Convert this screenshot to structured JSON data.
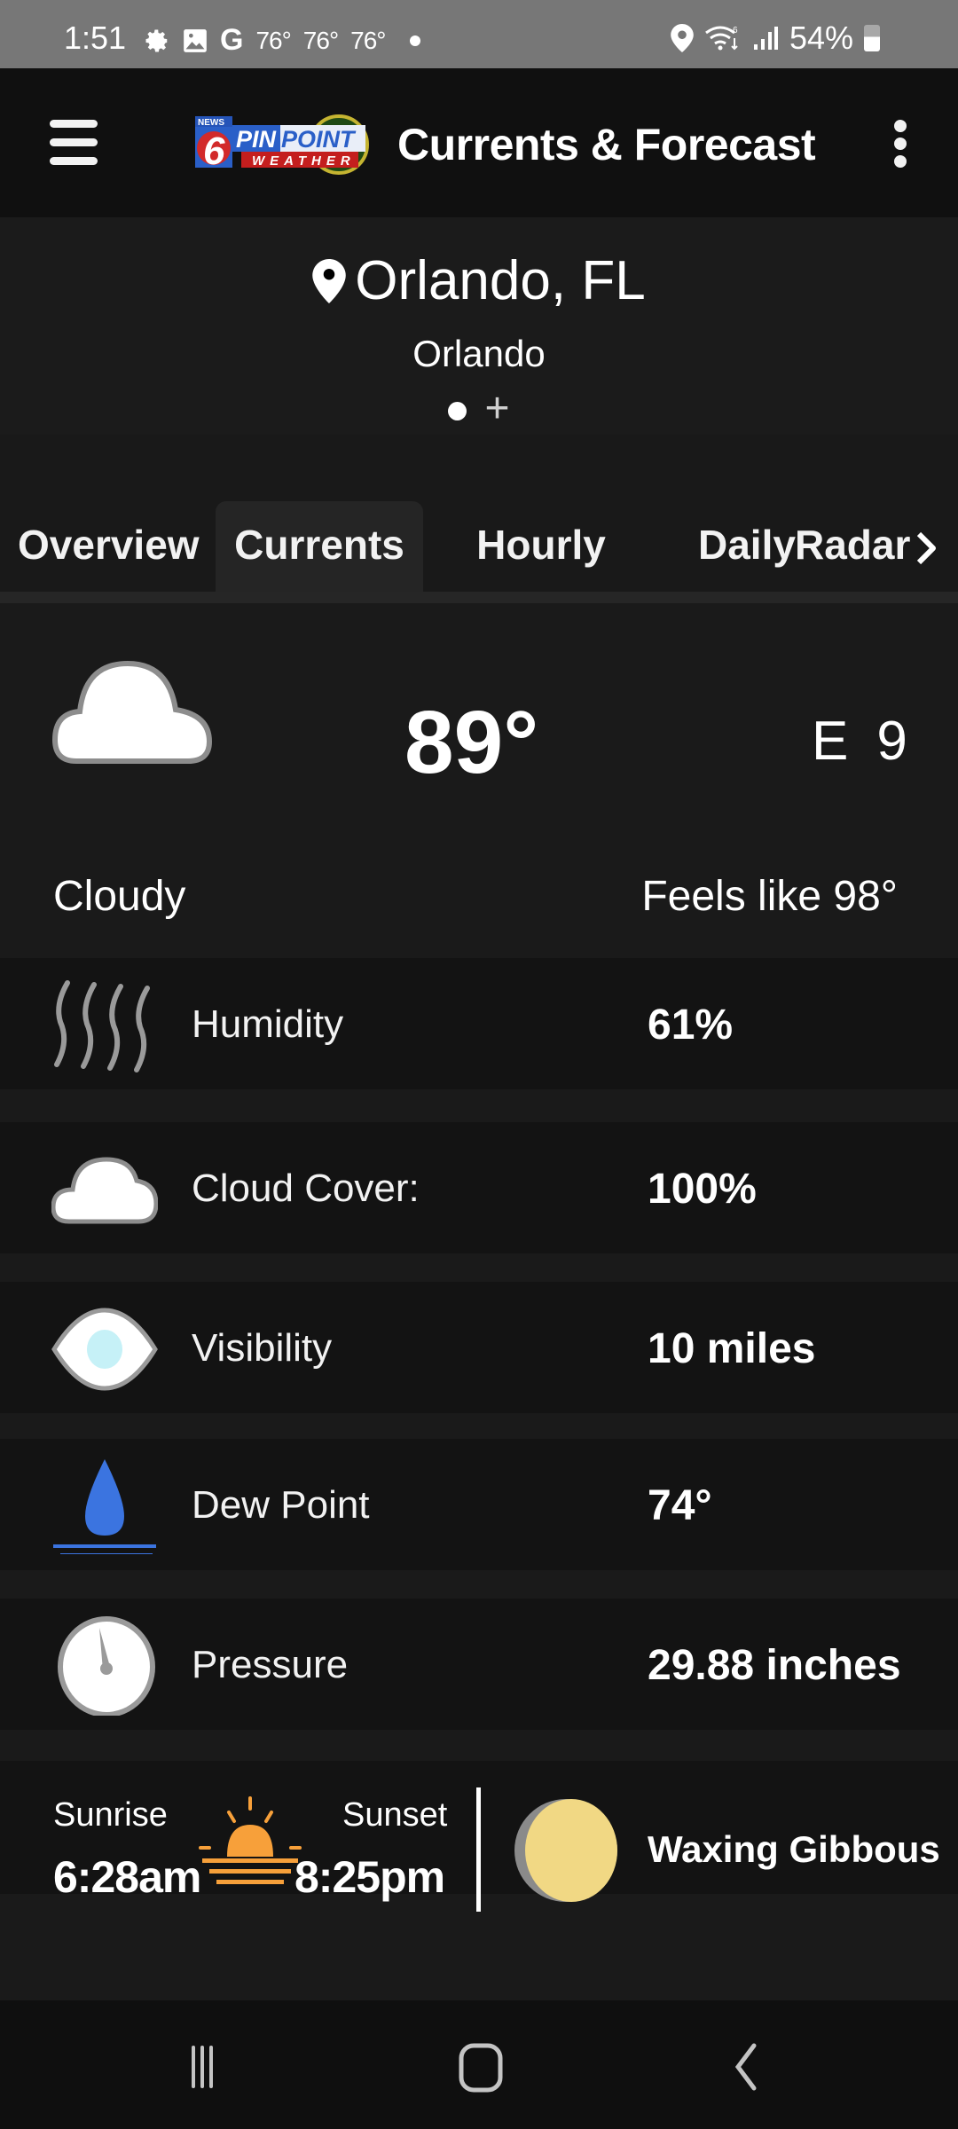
{
  "status_bar": {
    "time": "1:51",
    "left_icons": [
      "gear-icon",
      "image-icon",
      "google-icon"
    ],
    "temps": [
      "76°",
      "76°",
      "76°"
    ],
    "right_icons": [
      "location-icon",
      "wifi-icon",
      "signal-icon"
    ],
    "battery": "54%",
    "battery_level_percent": 54
  },
  "header": {
    "menu_icon": "hamburger-menu-icon",
    "logo": {
      "line1": "PINPOINT",
      "line2": "WEATHER",
      "badge": "NEWS",
      "number": "6"
    },
    "title": "Currents & Forecast",
    "more_icon": "more-vertical-icon"
  },
  "location": {
    "title": "Orlando, FL",
    "subtitle": "Orlando",
    "pager_add": "+"
  },
  "tabs": [
    {
      "label": "Overview",
      "active": false
    },
    {
      "label": "Currents",
      "active": true
    },
    {
      "label": "Hourly",
      "active": false
    },
    {
      "label": "Daily",
      "active": false
    },
    {
      "label": "Radar",
      "active": false
    }
  ],
  "current": {
    "icon": "cloud-icon",
    "temperature": "89°",
    "wind_direction": "E",
    "wind_speed": "9",
    "condition": "Cloudy",
    "feels_like": "Feels like 98°"
  },
  "details": [
    {
      "icon": "humidity-icon",
      "label": "Humidity",
      "value": "61%"
    },
    {
      "icon": "cloud-icon",
      "label": "Cloud Cover:",
      "value": "100%"
    },
    {
      "icon": "eye-icon",
      "label": "Visibility",
      "value": "10 miles"
    },
    {
      "icon": "dew-drop-icon",
      "label": "Dew Point",
      "value": "74°"
    },
    {
      "icon": "gauge-icon",
      "label": "Pressure",
      "value": "29.88 inches"
    }
  ],
  "sun": {
    "sunrise_label": "Sunrise",
    "sunrise_time": "6:28am",
    "sunset_label": "Sunset",
    "sunset_time": "8:25pm"
  },
  "moon": {
    "phase": "Waxing Gibbous"
  },
  "colors": {
    "sun": "#f7a03a",
    "moon": "#f1d884",
    "dew_drop": "#3b74e0",
    "eye_pupil": "#c6f1f7"
  }
}
